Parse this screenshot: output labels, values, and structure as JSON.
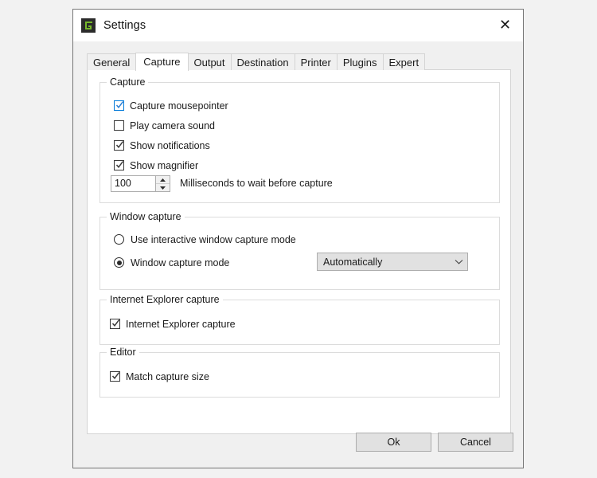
{
  "window": {
    "title": "Settings",
    "icon": "greenshot-logo-icon",
    "close_label": "✕",
    "accent_color": "#0078d7",
    "icon_color": "#76b82a",
    "icon_bg_color": "#2b2b2b"
  },
  "tabs": [
    {
      "label": "General",
      "selected": false
    },
    {
      "label": "Capture",
      "selected": true
    },
    {
      "label": "Output",
      "selected": false
    },
    {
      "label": "Destination",
      "selected": false
    },
    {
      "label": "Printer",
      "selected": false
    },
    {
      "label": "Plugins",
      "selected": false
    },
    {
      "label": "Expert",
      "selected": false
    }
  ],
  "capture_group": {
    "title": "Capture",
    "checkboxes": [
      {
        "label": "Capture mousepointer",
        "checked": true,
        "accent": true
      },
      {
        "label": "Play camera sound",
        "checked": false,
        "accent": false
      },
      {
        "label": "Show notifications",
        "checked": true,
        "accent": false
      },
      {
        "label": "Show magnifier",
        "checked": true,
        "accent": false
      }
    ],
    "wait_spinner": {
      "value": "100",
      "label": "Milliseconds to wait before capture",
      "up_icon": "spinner-up-arrow-icon",
      "down_icon": "spinner-down-arrow-icon"
    }
  },
  "window_capture_group": {
    "title": "Window capture",
    "radios": [
      {
        "label": "Use interactive window capture mode",
        "checked": false
      },
      {
        "label": "Window capture mode",
        "checked": true
      }
    ],
    "mode_combo": {
      "value": "Automatically",
      "chevron_icon": "chevron-down-icon"
    }
  },
  "ie_group": {
    "title": "Internet Explorer capture",
    "checkbox": {
      "label": "Internet Explorer capture",
      "checked": true
    }
  },
  "editor_group": {
    "title": "Editor",
    "checkbox": {
      "label": "Match capture size",
      "checked": true
    }
  },
  "buttons": {
    "ok_label": "Ok",
    "cancel_label": "Cancel"
  }
}
